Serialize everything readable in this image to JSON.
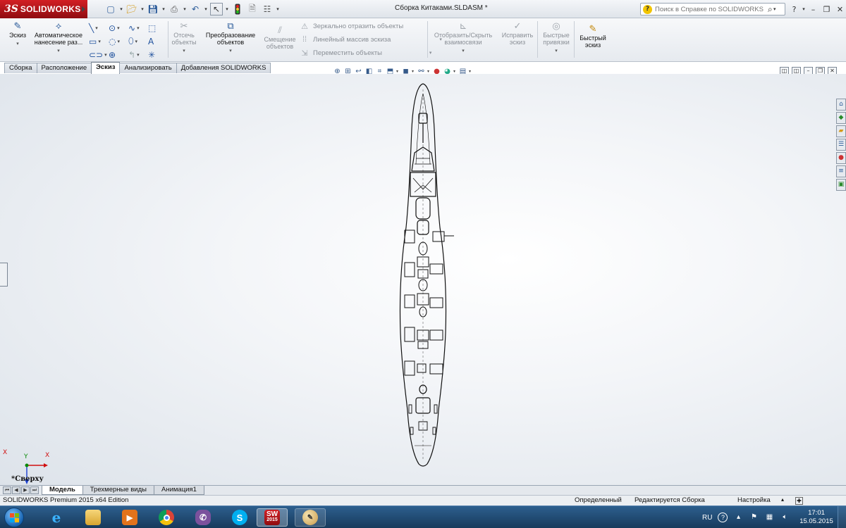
{
  "app": {
    "brand": "SOLIDWORKS",
    "logo_mark": "3S",
    "document_title": "Сборка Китаками.SLDASM *",
    "help_search_placeholder": "Поиск в Справке по SOLIDWORKS"
  },
  "quick_access": [
    {
      "icon": "new-document-icon"
    },
    {
      "icon": "open-folder-icon"
    },
    {
      "icon": "save-icon"
    },
    {
      "icon": "print-icon"
    },
    {
      "icon": "undo-icon"
    },
    {
      "icon": "select-pointer-icon"
    },
    {
      "icon": "rebuild-traffic-light-icon"
    },
    {
      "icon": "file-properties-icon"
    },
    {
      "icon": "options-icon"
    }
  ],
  "ribbon": {
    "sketch": "Эскиз",
    "smart_dimension": "Автоматическое нанесение раз...",
    "trim": "Отсечь объекты",
    "convert": "Преобразование объектов",
    "offset": "Смещение объектов",
    "mirror": "Зеркально отразить объекты",
    "linear_pattern": "Линейный массив эскиза",
    "move": "Переместить объекты",
    "show_relations": "Отобразить/Скрыть взаимосвязи",
    "repair": "Исправить эскиз",
    "quick_snaps": "Быстрые привязки",
    "rapid_sketch": "Быстрый эскиз"
  },
  "tabs": [
    "Сборка",
    "Расположение",
    "Эскиз",
    "Анализировать",
    "Добавления SOLIDWORKS"
  ],
  "active_tab": "Эскиз",
  "view": {
    "orientation": "*Сверху",
    "axis_x": "X",
    "axis_y": "Y",
    "axis_z": "Z"
  },
  "bottom_tabs": [
    "Модель",
    "Трехмерные виды",
    "Анимация1"
  ],
  "status": {
    "edition": "SOLIDWORKS Premium 2015 x64 Edition",
    "definition": "Определенный",
    "editing": "Редактируется Сборка",
    "settings": "Настройка"
  },
  "taskbar": {
    "apps": [
      {
        "name": "Internet Explorer",
        "icon": "internet-explorer-icon"
      },
      {
        "name": "Проводник",
        "icon": "file-explorer-icon"
      },
      {
        "name": "Media Player",
        "icon": "media-player-icon"
      },
      {
        "name": "Google Chrome",
        "icon": "chrome-icon"
      },
      {
        "name": "Viber",
        "icon": "viber-icon"
      },
      {
        "name": "Skype",
        "icon": "skype-icon"
      },
      {
        "name": "SOLIDWORKS 2015",
        "icon": "solidworks-icon",
        "label": "2015"
      },
      {
        "name": "Paint",
        "icon": "paint-icon"
      }
    ],
    "language": "RU",
    "time": "17:01",
    "date": "15.05.2015"
  },
  "colors": {
    "brand_red": "#c8161d",
    "accent_blue": "#2b5b9a",
    "taskbar_blue": "#1f4a72",
    "axis_red": "#d01010",
    "axis_green": "#0a8a0a",
    "axis_blue": "#1a3fcf"
  }
}
